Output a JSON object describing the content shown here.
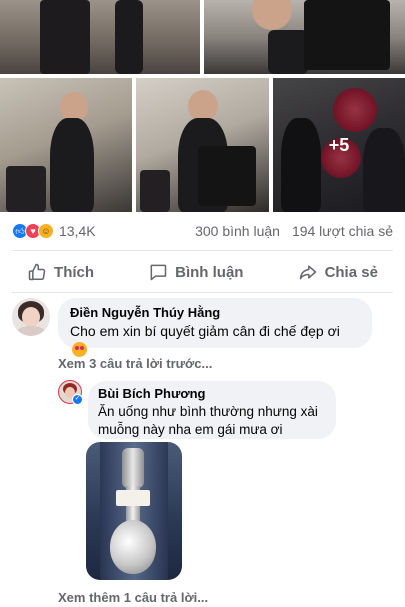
{
  "post": {
    "reactions": {
      "count": "13,4K",
      "comments": "300 bình luận",
      "shares": "194 lượt chia sẻ"
    },
    "photos": {
      "more_overlay": "+5"
    },
    "actions": {
      "like": "Thích",
      "comment": "Bình luận",
      "share": "Chia sẻ"
    }
  },
  "comments": [
    {
      "author": "Điền Nguyễn Thúy Hằng",
      "text": "Cho em xin bí quyết giảm cân đi chế đẹp ơi",
      "view_previous": "Xem 3 câu trả lời trước..."
    }
  ],
  "reply": {
    "author": "Bùi Bích Phương",
    "text_line1": "Ăn uống như bình thường nhưng xài",
    "text_line2": "muỗng này nha em gái mưa ơi",
    "view_more": "Xem thêm 1 câu trả lời..."
  },
  "colors": {
    "accent": "#1877f2",
    "bubble": "#f0f2f5",
    "muted_text": "#65676b"
  }
}
